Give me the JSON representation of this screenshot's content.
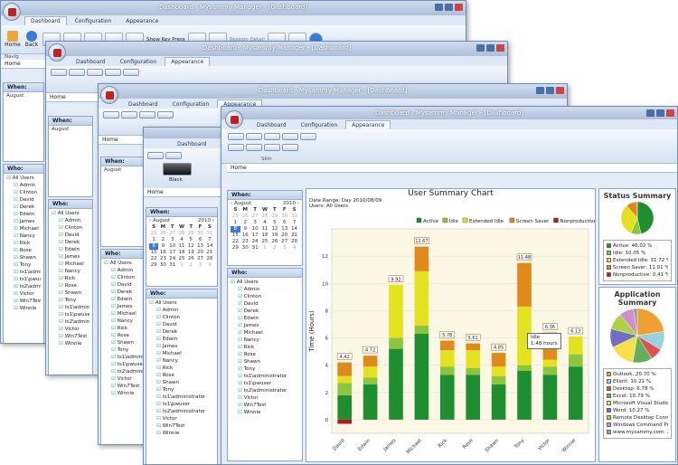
{
  "app": {
    "title": "Dashboard - Mysammy Manager - [Dashboard]",
    "tabs": [
      "Dashboard",
      "Configuration",
      "Appearance"
    ],
    "nav_buttons": [
      "Home",
      "Back",
      "Navig"
    ],
    "toolbar": {
      "show_key_press": "Show Key Press",
      "session_detail": "Session Detail"
    }
  },
  "breadcrumb": "Home",
  "skin_label": "Skin",
  "black_label": "Black",
  "when_label": "When:",
  "who_label": "Who:",
  "calendar": {
    "month": "August",
    "year": "2010",
    "days_header": [
      "S",
      "M",
      "T",
      "W",
      "T",
      "F",
      "S"
    ],
    "weeks": [
      [
        "25",
        "26",
        "27",
        "28",
        "29",
        "30",
        "31"
      ],
      [
        "1",
        "2",
        "3",
        "4",
        "5",
        "6",
        "7"
      ],
      [
        "8",
        "9",
        "10",
        "11",
        "12",
        "13",
        "14"
      ],
      [
        "15",
        "16",
        "17",
        "18",
        "19",
        "20",
        "21"
      ],
      [
        "22",
        "23",
        "24",
        "25",
        "26",
        "27",
        "28"
      ],
      [
        "29",
        "30",
        "31",
        "1",
        "2",
        "3",
        "4"
      ]
    ],
    "selected": "8"
  },
  "users": [
    "All Users",
    "Admin",
    "Clinton",
    "David",
    "Derek",
    "Edwin",
    "James",
    "Michael",
    "Nancy",
    "Rick",
    "Rose",
    "Shawn",
    "Tony",
    "ts1\\administrator",
    "ts1\\pwuser",
    "ts2\\administrator",
    "Victor",
    "Win7Test",
    "Winnie"
  ],
  "chart_data": {
    "type": "bar",
    "title": "User Summary Chart",
    "date_range": "Date Range: Day 2010/08/09",
    "users_label": "Users: All Users",
    "ylabel": "Time (Hours)",
    "ylim": [
      -1,
      14
    ],
    "yticks": [
      0,
      2,
      4,
      6,
      8,
      10,
      12
    ],
    "categories": [
      "David",
      "Edwin",
      "James",
      "Michael",
      "Rick",
      "Rose",
      "Shawn",
      "Tony",
      "Victor",
      "Winnie"
    ],
    "totals": [
      "4.42",
      "4.72",
      "9.92",
      "12.67",
      "5.78",
      "5.61",
      "4.85",
      "11.48",
      "6.36",
      "6.13"
    ],
    "series": [
      {
        "name": "Active",
        "color": "#1e8f2e",
        "values": [
          1.8,
          2.6,
          5.2,
          6.3,
          3.3,
          3.3,
          2.6,
          3.6,
          3.3,
          3.9
        ]
      },
      {
        "name": "Idle",
        "color": "#8cc63f",
        "values": [
          0.9,
          0.5,
          0.8,
          0.6,
          0.6,
          0.5,
          0.6,
          0.4,
          0.6,
          0.9
        ]
      },
      {
        "name": "Extended Idle",
        "color": "#e4e21f",
        "values": [
          0.5,
          0.8,
          3.9,
          4.0,
          1.2,
          1.3,
          0.7,
          4.3,
          0.5,
          1.3
        ]
      },
      {
        "name": "Screen Saver",
        "color": "#e08a1a",
        "values": [
          1.0,
          0.8,
          0,
          1.8,
          0.7,
          0.5,
          1.0,
          3.2,
          2.0,
          0
        ]
      },
      {
        "name": "Nonproductive",
        "color": "#b31b1b",
        "values": [
          -0.3,
          0,
          0,
          0,
          0,
          0,
          0,
          0,
          0,
          0
        ]
      }
    ],
    "tooltip": {
      "title": "Idle",
      "value": "1:48 hours"
    }
  },
  "status_summary": {
    "title": "Status Summary",
    "items": [
      {
        "label": "Active: 46.02 %",
        "color": "#1e8f2e",
        "value": 46.02
      },
      {
        "label": "Idle: 10.05 %",
        "color": "#8cc63f",
        "value": 10.05
      },
      {
        "label": "Extended Idle: 31.72 %",
        "color": "#e4e21f",
        "value": 31.72
      },
      {
        "label": "Screen Saver: 11.01 %",
        "color": "#e08a1a",
        "value": 11.01
      },
      {
        "label": "Nonproductive: 0.41 %",
        "color": "#b31b1b",
        "value": 0.41
      }
    ]
  },
  "app_summary": {
    "title": "Application Summary",
    "items": [
      {
        "label": "Outlook: 20.70 %",
        "color": "#f0a030",
        "value": 20.7
      },
      {
        "label": "Elliott: 10.21 %",
        "color": "#9bd0e0",
        "value": 10.21
      },
      {
        "label": "Desktop: 6.78 %",
        "color": "#e05050",
        "value": 6.78
      },
      {
        "label": "Excel: 10.79 %",
        "color": "#60b060",
        "value": 10.79
      },
      {
        "label": "Microsoft Visual Studio 20",
        "color": "#f6e04a",
        "value": 14
      },
      {
        "label": "Word: 10.27 %",
        "color": "#7070c0",
        "value": 10.27
      },
      {
        "label": "Remote Desktop Connecti",
        "color": "#b0d040",
        "value": 9
      },
      {
        "label": "Windows Command Proce",
        "color": "#d090d0",
        "value": 8
      },
      {
        "label": "www.mysammy.com: 2.2",
        "color": "#a0a0a0",
        "value": 2.2
      }
    ]
  }
}
